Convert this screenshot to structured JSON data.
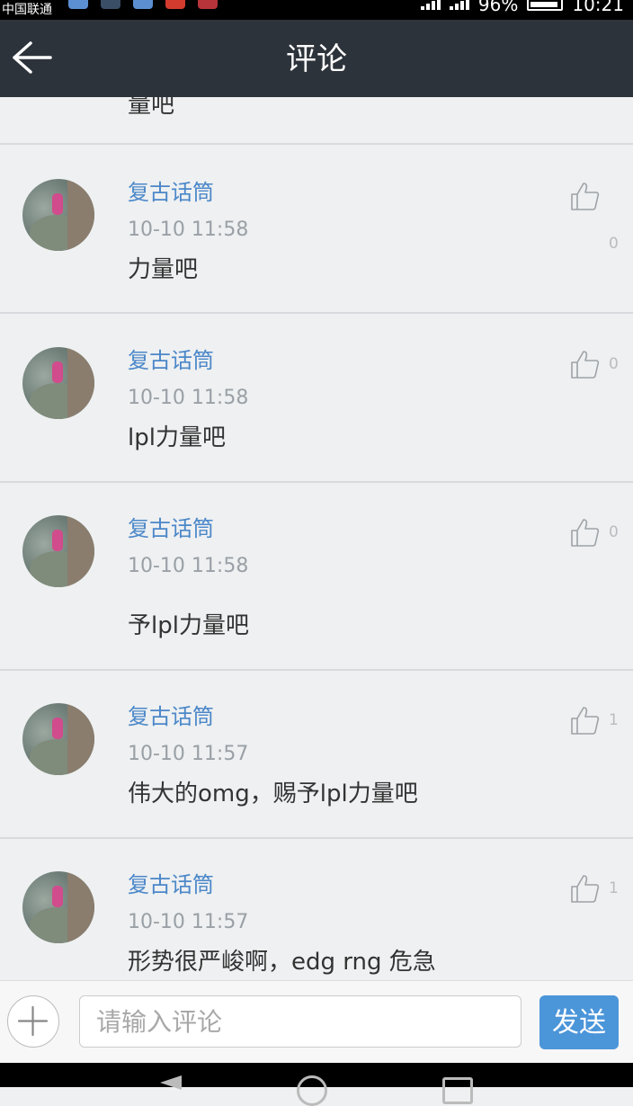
{
  "status_bar": {
    "carrier": "中国联通",
    "battery": "96%",
    "clock": "10:21"
  },
  "header": {
    "title": "评论"
  },
  "partial_comment": {
    "text": "量吧"
  },
  "comments": [
    {
      "name": "复古话筒",
      "time": "10-10 11:58",
      "text": "力量吧",
      "likes": "0"
    },
    {
      "name": "复古话筒",
      "time": "10-10 11:58",
      "text": "lpl力量吧",
      "likes": "0"
    },
    {
      "name": "复古话筒",
      "time": "10-10 11:58",
      "text": "予lpl力量吧",
      "likes": "0"
    },
    {
      "name": "复古话筒",
      "time": "10-10 11:57",
      "text": "伟大的omg，赐予lpl力量吧",
      "likes": "1"
    },
    {
      "name": "复古话筒",
      "time": "10-10 11:57",
      "text": "形势很严峻啊，edg rng 危急",
      "likes": "1"
    }
  ],
  "input_bar": {
    "placeholder": "请输入评论",
    "value": "",
    "send_label": "发送"
  },
  "icons": {
    "back": "arrow-left-icon",
    "like": "thumbs-up-icon",
    "add": "plus-icon",
    "nav": [
      "nav-back-icon",
      "nav-home-icon",
      "nav-recent-icon"
    ]
  },
  "colors": {
    "title_bar": "#2d333a",
    "name_blue": "#4b87c9",
    "send_button": "#4b95d9"
  }
}
